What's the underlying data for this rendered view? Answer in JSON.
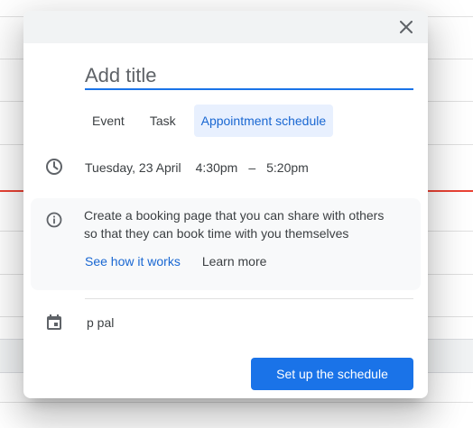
{
  "title_field": {
    "placeholder": "Add title",
    "value": ""
  },
  "tabs": [
    {
      "label": "Event",
      "active": false
    },
    {
      "label": "Task",
      "active": false
    },
    {
      "label": "Appointment schedule",
      "active": true
    }
  ],
  "time": {
    "date": "Tuesday, 23 April",
    "start": "4:30pm",
    "separator": "–",
    "end": "5:20pm"
  },
  "info": {
    "text": "Create a booking page that you can share with others so that they can book time with you themselves",
    "link_primary": "See how it works",
    "link_secondary": "Learn more"
  },
  "calendar": {
    "name": "p pal"
  },
  "actions": {
    "primary_label": "Set up the schedule"
  },
  "icons": {
    "close": "close-icon",
    "time": "clock-icon",
    "info": "info-icon",
    "calendar": "calendar-event-icon"
  },
  "colors": {
    "accent": "#1a73e8",
    "accent_text": "#1967d2",
    "tab_active_bg": "#e8f0fe",
    "header_bg": "#f1f3f4",
    "card_bg": "#f8f9fa",
    "now_line": "#ea4335"
  }
}
